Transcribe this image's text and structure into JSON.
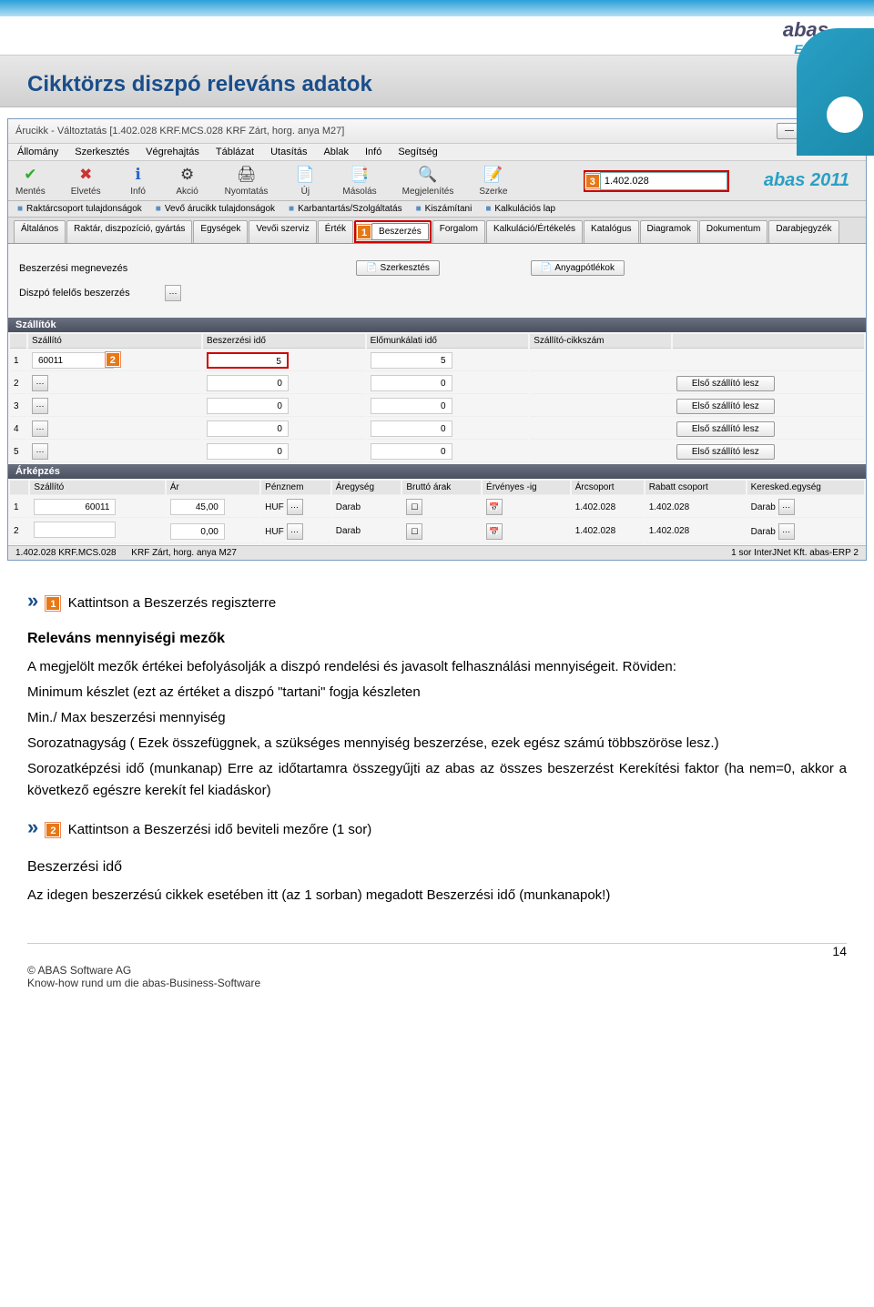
{
  "page_title": "Cikktörzs diszpó releváns adatok",
  "erp_brand": {
    "abas": "abas",
    "erp": "ERP"
  },
  "window": {
    "title": "Árucikk - Változtatás [1.402.028  KRF.MCS.028  KRF Zárt, horg. anya M27]",
    "menu": [
      "Állomány",
      "Szerkesztés",
      "Végrehajtás",
      "Táblázat",
      "Utasítás",
      "Ablak",
      "Infó",
      "Segítség"
    ],
    "toolbar": [
      {
        "label": "Mentés",
        "icon": "✔",
        "color": "#3a3"
      },
      {
        "label": "Elvetés",
        "icon": "✖",
        "color": "#c33"
      },
      {
        "label": "Infó",
        "icon": "ℹ",
        "color": "#26c"
      },
      {
        "label": "Akció",
        "icon": "⚙",
        "color": "#888"
      },
      {
        "label": "Nyomtatás",
        "icon": "🖨",
        "color": "#555"
      },
      {
        "label": "Új",
        "icon": "📄",
        "color": "#555"
      },
      {
        "label": "Másolás",
        "icon": "📑",
        "color": "#555"
      },
      {
        "label": "Megjelenítés",
        "icon": "🔍",
        "color": "#555"
      },
      {
        "label": "Szerke",
        "icon": "📝",
        "color": "#555"
      }
    ],
    "badge3": "3",
    "search_value": "1.402.028",
    "abas2011": "abas 2011",
    "linkbar": [
      "Raktárcsoport tulajdonságok",
      "Vevő árucikk tulajdonságok",
      "Karbantartás/Szolgáltatás",
      "Kiszámítani",
      "Kalkulációs lap"
    ],
    "tabs": [
      "Általános",
      "Raktár, diszpozíció, gyártás",
      "Egységek",
      "Vevői szerviz",
      "Érték"
    ],
    "badge1": "1",
    "tabs2": [
      "Beszerzés",
      "Forgalom",
      "Kalkuláció/Értékelés",
      "Katalógus",
      "Diagramok",
      "Dokumentum",
      "Darabjegyzék"
    ],
    "form": {
      "lbl_besz_megnev": "Beszerzési megnevezés",
      "btn_szerk": "Szerkesztés",
      "btn_anyag": "Anyagpótlékok",
      "lbl_diszpo": "Diszpó felelős beszerzés"
    },
    "suppliers": {
      "header": "Szállítók",
      "cols": [
        "Szállító",
        "Beszerzési idő",
        "Előmunkálati idő",
        "Szállító-cikkszám"
      ],
      "badge2": "2",
      "rows": [
        {
          "n": "1",
          "szall": "60011",
          "besz": "5",
          "elo": "5",
          "btn": ""
        },
        {
          "n": "2",
          "szall": "",
          "besz": "0",
          "elo": "0",
          "btn": "Első szállító lesz"
        },
        {
          "n": "3",
          "szall": "",
          "besz": "0",
          "elo": "0",
          "btn": "Első szállító lesz"
        },
        {
          "n": "4",
          "szall": "",
          "besz": "0",
          "elo": "0",
          "btn": "Első szállító lesz"
        },
        {
          "n": "5",
          "szall": "",
          "besz": "0",
          "elo": "0",
          "btn": "Első szállító lesz"
        }
      ]
    },
    "pricing": {
      "header": "Árképzés",
      "cols": [
        "Szállító",
        "Ár",
        "Pénznem",
        "Áregység",
        "Bruttó árak",
        "Érvényes -ig",
        "Árcsoport",
        "Rabatt csoport",
        "Keresked.egység"
      ],
      "rows": [
        {
          "n": "1",
          "szall": "60011",
          "ar": "45,00",
          "penz": "HUF",
          "egys": "Darab",
          "brut": "",
          "erv": "",
          "arcs": "1.402.028",
          "rab": "1.402.028",
          "ker": "Darab"
        },
        {
          "n": "2",
          "szall": "",
          "ar": "0,00",
          "penz": "HUF",
          "egys": "Darab",
          "brut": "",
          "erv": "",
          "arcs": "1.402.028",
          "rab": "1.402.028",
          "ker": "Darab"
        }
      ]
    },
    "status": {
      "left": "1.402.028 KRF.MCS.028",
      "mid": "KRF Zárt, horg. anya M27",
      "right": "1 sor   InterJNet Kft.   abas-ERP   2"
    }
  },
  "body": {
    "step1": "Kattintson a Beszerzés  regiszterre",
    "h_relevans": "Releváns mennyiségi mezők",
    "p1": "A megjelölt mezők értékei befolyásolják a diszpó rendelési és javasolt felhasználási mennyiségeit. Röviden:",
    "p2": "Minimum készlet (ezt az értéket a diszpó \"tartani\" fogja készleten",
    "p3": "Min./ Max beszerzési mennyiség",
    "p4": "Sorozatnagyság ( Ezek összefüggnek, a szükséges mennyiség beszerzése, ezek egész számú többszöröse lesz.)",
    "p5": "Sorozatképzési idő (munkanap) Erre az időtartamra összegyűjti az abas az összes beszerzést Kerekítési faktor (ha nem=0, akkor a következő egészre kerekít fel kiadáskor)",
    "step2": "Kattintson  a Beszerzési idő beviteli mezőre (1 sor)",
    "h_beszido": "Beszerzési idő",
    "p6": "Az idegen beszerzésú cikkek esetében itt (az 1 sorban) megadott Beszerzési idő (munkanapok!)"
  },
  "footer": {
    "copyright": "© ABAS Software AG",
    "sub": "Know-how rund um die abas-Business-Software",
    "page": "14"
  }
}
